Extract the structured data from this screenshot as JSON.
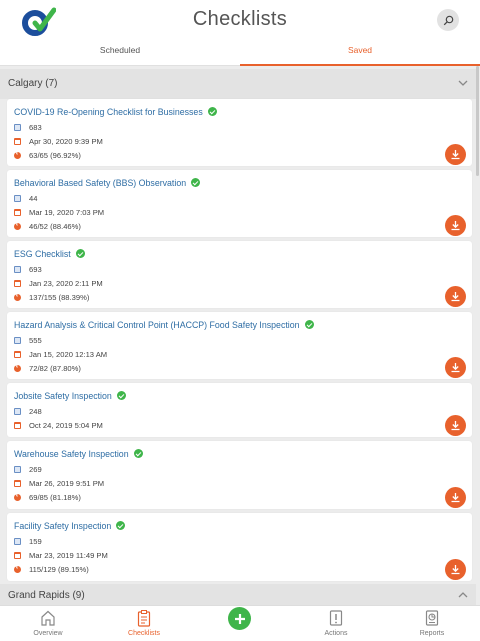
{
  "header": {
    "title": "Checklists"
  },
  "tabs": [
    {
      "label": "Scheduled"
    },
    {
      "label": "Saved"
    }
  ],
  "groups": [
    {
      "title": "Calgary (7)"
    },
    {
      "title": "Grand Rapids (9)"
    }
  ],
  "cards": [
    {
      "title": "COVID-19 Re-Opening Checklist for Businesses",
      "id": "683",
      "date": "Apr 30, 2020 9:39 PM",
      "progress": "63/65 (96.92%)"
    },
    {
      "title": "Behavioral Based Safety (BBS) Observation",
      "id": "44",
      "date": "Mar 19, 2020 7:03 PM",
      "progress": "46/52 (88.46%)"
    },
    {
      "title": "ESG Checklist",
      "id": "693",
      "date": "Jan 23, 2020 2:11 PM",
      "progress": "137/155 (88.39%)"
    },
    {
      "title": "Hazard Analysis & Critical Control Point (HACCP) Food Safety Inspection",
      "id": "555",
      "date": "Jan 15, 2020 12:13 AM",
      "progress": "72/82 (87.80%)"
    },
    {
      "title": "Jobsite Safety Inspection",
      "id": "248",
      "date": "Oct 24, 2019 5:04 PM"
    },
    {
      "title": "Warehouse Safety Inspection",
      "id": "269",
      "date": "Mar 26, 2019 9:51 PM",
      "progress": "69/85 (81.18%)"
    },
    {
      "title": "Facility Safety Inspection",
      "id": "159",
      "date": "Mar 23, 2019 11:49 PM",
      "progress": "115/129 (89.15%)"
    }
  ],
  "nav": [
    {
      "label": "Overview"
    },
    {
      "label": "Checklists"
    },
    {
      "label": "Actions"
    },
    {
      "label": "Reports"
    }
  ],
  "colors": {
    "accent": "#e8612c",
    "link": "#2e6da4",
    "success": "#3fb54a"
  }
}
